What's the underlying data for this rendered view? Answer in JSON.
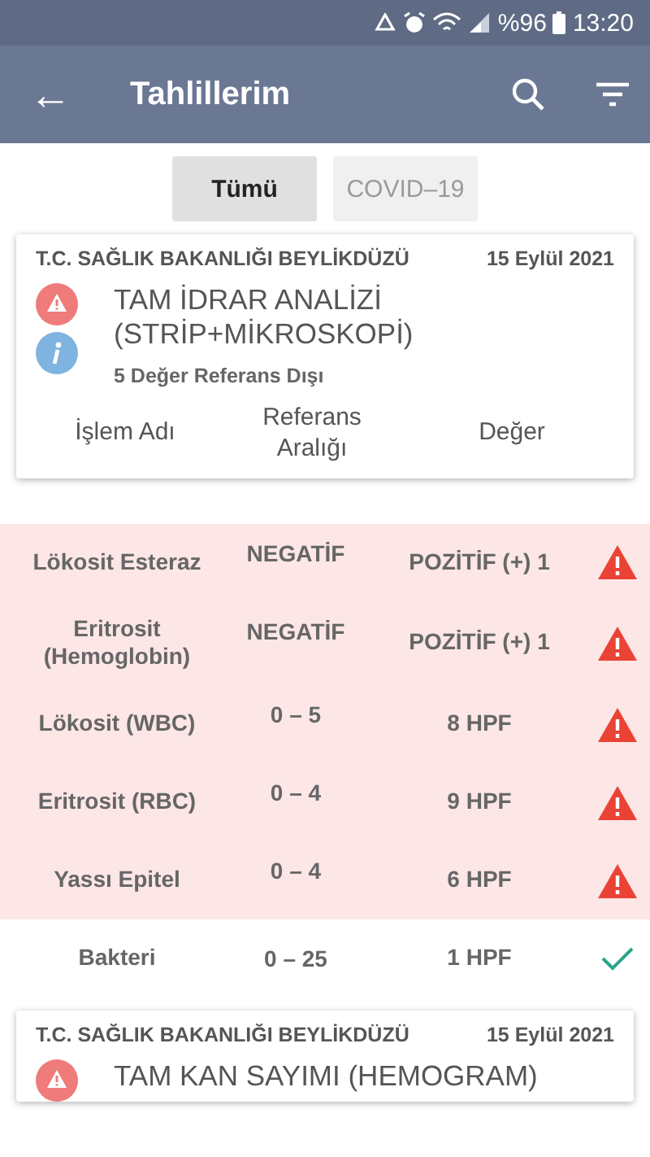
{
  "status_bar": {
    "battery": "%96",
    "time": "13:20"
  },
  "app_bar": {
    "back": "←",
    "title": "Tahlillerim"
  },
  "tabs": [
    {
      "label": "Tümü",
      "selected": true
    },
    {
      "label": "COVID–19",
      "selected": false
    }
  ],
  "cards": [
    {
      "institution": "T.C. SAĞLIK BAKANLIĞI BEYLİKDÜZÜ",
      "date": "15 Eylül 2021",
      "title": "TAM İDRAR ANALİZİ (STRİP+MİKROSKOPİ)",
      "summary": "5 Değer Referans Dışı",
      "has_alert": true,
      "has_info": true,
      "columns": [
        "İşlem Adı",
        "Referans Aralığı",
        "Değer"
      ],
      "rows": [
        {
          "name": "Lökosit Esteraz",
          "reference": "NEGATİF",
          "value": "POZİTİF (+) 1",
          "flagged": true
        },
        {
          "name": "Eritrosit (Hemoglobin)",
          "reference": "NEGATİF",
          "value": "POZİTİF (+) 1",
          "flagged": true
        },
        {
          "name": "Lökosit (WBC)",
          "reference": "0 – 5",
          "value": "8 HPF",
          "flagged": true
        },
        {
          "name": "Eritrosit (RBC)",
          "reference": "0 – 4",
          "value": "9 HPF",
          "flagged": true
        },
        {
          "name": "Yassı Epitel",
          "reference": "0 – 4",
          "value": "6 HPF",
          "flagged": true
        },
        {
          "name": "Bakteri",
          "reference": "0 – 25",
          "value": "1 HPF",
          "flagged": false
        }
      ]
    },
    {
      "institution": "T.C. SAĞLIK BAKANLIĞI BEYLİKDÜZÜ",
      "date": "15 Eylül 2021",
      "title": "TAM KAN SAYIMI (HEMOGRAM)",
      "has_alert": true
    }
  ]
}
